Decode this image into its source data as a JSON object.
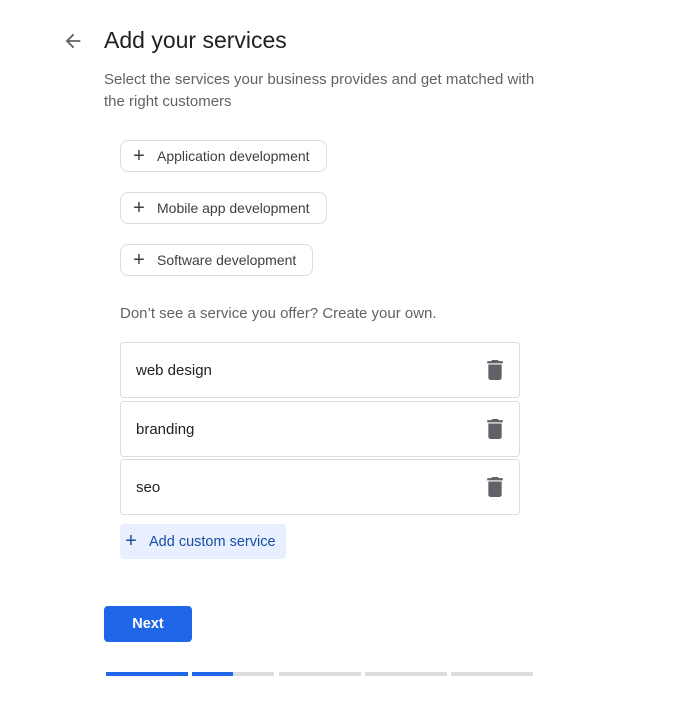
{
  "header": {
    "title": "Add your services",
    "subtitle": "Select the services your business provides and get matched with the right customers",
    "back_icon": "arrow-left-icon"
  },
  "suggestions": [
    {
      "label": "Application development",
      "icon": "plus-icon"
    },
    {
      "label": "Mobile app development",
      "icon": "plus-icon"
    },
    {
      "label": "Software development",
      "icon": "plus-icon"
    }
  ],
  "custom_hint": "Don’t see a service you offer? Create your own.",
  "custom_services": [
    {
      "value": "web design",
      "icon": "trash-icon"
    },
    {
      "value": "branding",
      "icon": "trash-icon"
    },
    {
      "value": "seo",
      "icon": "trash-icon"
    }
  ],
  "add_custom_label": "Add custom service",
  "next_label": "Next",
  "progress": {
    "steps": 5,
    "step_fill": [
      1,
      0.5,
      0,
      0,
      0
    ]
  },
  "colors": {
    "accent": "#1f66e8",
    "add_bg": "#e8efff",
    "add_text": "#174ea6"
  }
}
